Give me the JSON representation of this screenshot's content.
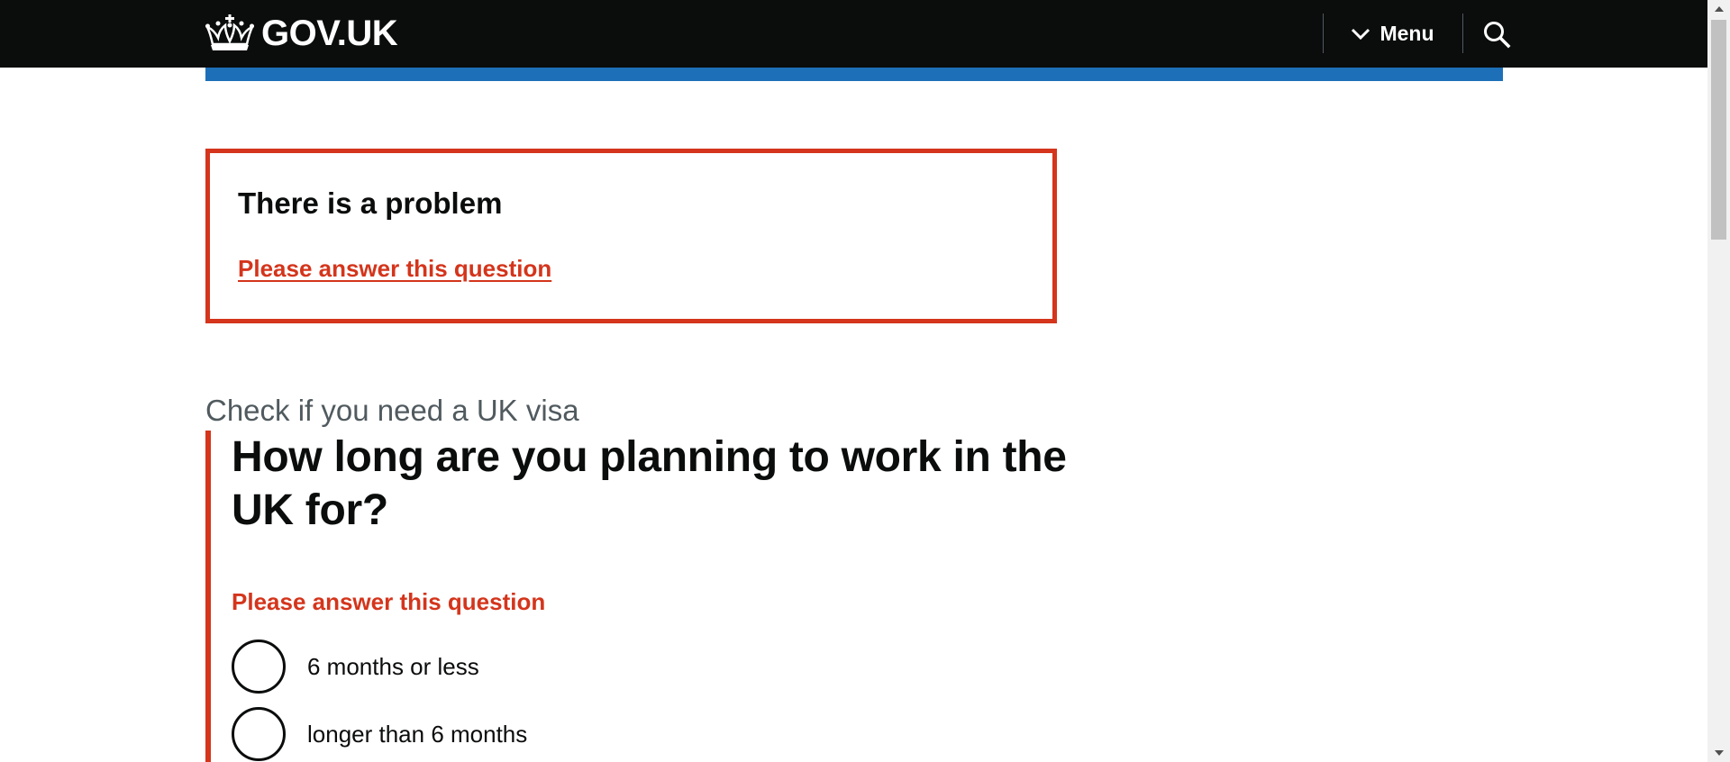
{
  "header": {
    "logo_text": "GOV.UK",
    "menu_label": "Menu",
    "colors": {
      "background": "#0b0c0c",
      "accent_bar": "#1d70b8"
    }
  },
  "error_summary": {
    "title": "There is a problem",
    "link_text": "Please answer this question",
    "color": "#d4351c"
  },
  "question": {
    "caption": "Check if you need a UK visa",
    "heading": "How long are you planning to work in the UK for?",
    "error_message": "Please answer this question",
    "options": [
      {
        "label": "6 months or less",
        "selected": false
      },
      {
        "label": "longer than 6 months",
        "selected": false
      }
    ]
  }
}
